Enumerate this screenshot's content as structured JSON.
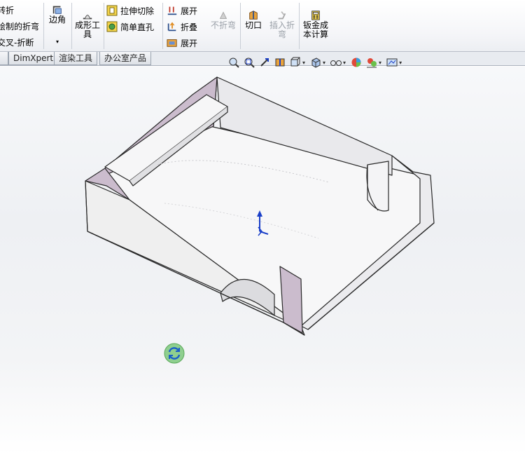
{
  "ribbon": {
    "left_column": [
      "转折",
      "绘制的折弯",
      "交叉-折断"
    ],
    "corner": {
      "label": "边角"
    },
    "forming_tool": {
      "label_line1": "成形工",
      "label_line2": "具"
    },
    "cut_column": [
      "拉伸切除",
      "简单直孔"
    ],
    "unfold_column": [
      "展开",
      "折叠",
      "展开"
    ],
    "no_bends": {
      "label": "不折弯"
    },
    "rip": {
      "label": "切口"
    },
    "insert_bends": {
      "label_line1": "插入折",
      "label_line2": "弯"
    },
    "sheet_cost": {
      "label_line1": "钣金成",
      "label_line2": "本计算"
    }
  },
  "tabs": [
    "DimXpert",
    "渲染工具",
    "办公室产品"
  ],
  "heads_up_toolbar": {
    "icons": [
      "zoom-to-fit-icon",
      "zoom-area-icon",
      "previous-view-icon",
      "section-view-icon",
      "view-orientation-icon",
      "display-style-icon",
      "hide-show-items-icon",
      "edit-appearance-icon",
      "apply-scene-icon",
      "view-settings-icon"
    ]
  },
  "colors": {
    "accent": "#3a5fa8",
    "part_face": "#f2f2f4",
    "edge": "#2a2a2a",
    "tinted_face": "#cbbccd",
    "rebuild_green": "#5aa95a"
  }
}
